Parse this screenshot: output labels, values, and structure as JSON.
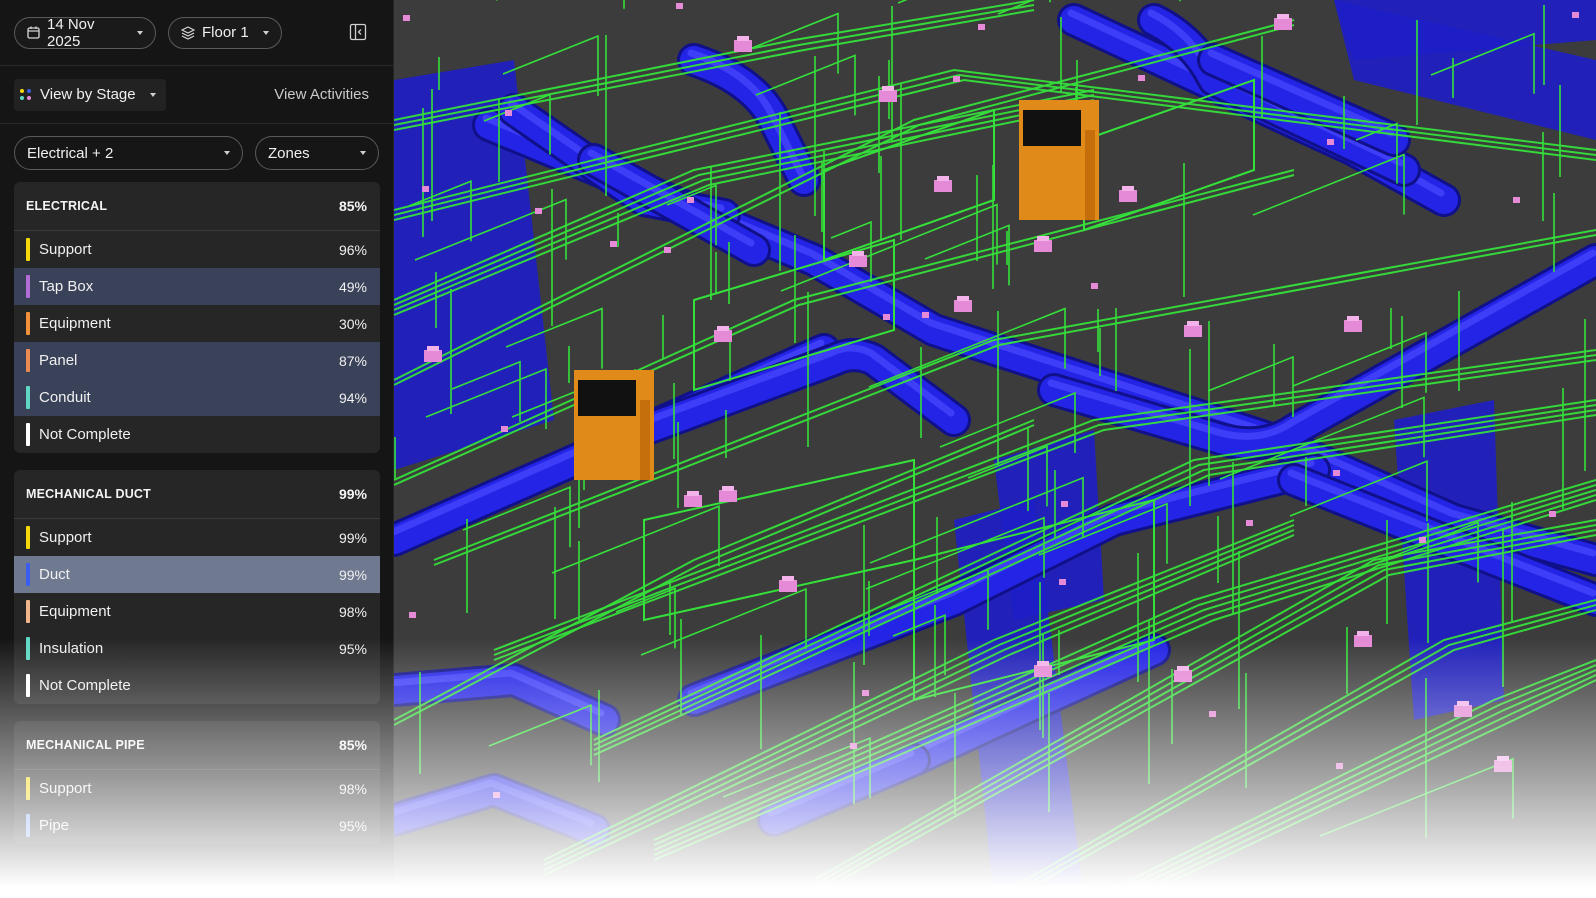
{
  "topbar": {
    "date_label": "14 Nov 2025",
    "floor_label": "Floor 1",
    "calendar_icon": "calendar-icon",
    "layers_icon": "layers-icon",
    "collapse_icon": "collapse-panel-icon"
  },
  "viewbar": {
    "stage_label": "View by Stage",
    "activities_label": "View Activities",
    "stage_icon": "colored-dots-icon"
  },
  "filters": {
    "trade_select": "Electrical + 2",
    "zone_select": "Zones"
  },
  "sections": [
    {
      "title": "ELECTRICAL",
      "percent": "85%",
      "rows": [
        {
          "label": "Support",
          "percent": "96%",
          "color": "#f5d90a",
          "highlight": "none"
        },
        {
          "label": "Tap Box",
          "percent": "49%",
          "color": "#b46cd8",
          "highlight": "dark"
        },
        {
          "label": "Equipment",
          "percent": "30%",
          "color": "#f3913b",
          "highlight": "none"
        },
        {
          "label": "Panel",
          "percent": "87%",
          "color": "#ec8a54",
          "highlight": "dark"
        },
        {
          "label": "Conduit",
          "percent": "94%",
          "color": "#5fd7c4",
          "highlight": "dark"
        },
        {
          "label": "Not Complete",
          "percent": "",
          "color": "#ffffff",
          "highlight": "none"
        }
      ]
    },
    {
      "title": "MECHANICAL DUCT",
      "percent": "99%",
      "rows": [
        {
          "label": "Support",
          "percent": "99%",
          "color": "#f5d90a",
          "highlight": "none"
        },
        {
          "label": "Duct",
          "percent": "99%",
          "color": "#3a5ff0",
          "highlight": "light"
        },
        {
          "label": "Equipment",
          "percent": "98%",
          "color": "#f0b58a",
          "highlight": "none"
        },
        {
          "label": "Insulation",
          "percent": "95%",
          "color": "#5fd7c4",
          "highlight": "none"
        },
        {
          "label": "Not Complete",
          "percent": "",
          "color": "#ffffff",
          "highlight": "none"
        }
      ]
    },
    {
      "title": "MECHANICAL PIPE",
      "percent": "85%",
      "rows": [
        {
          "label": "Support",
          "percent": "98%",
          "color": "#f5d90a",
          "highlight": "none"
        },
        {
          "label": "Pipe",
          "percent": "95%",
          "color": "#7aa3ff",
          "highlight": "none"
        }
      ]
    }
  ],
  "viewport": {
    "duct_color": "#2424e6",
    "conduit_color": "#35e03a",
    "equipment_color": "#e08a1a",
    "tapbox_color": "#e58ad6",
    "background_color": "#3c3c3c"
  }
}
